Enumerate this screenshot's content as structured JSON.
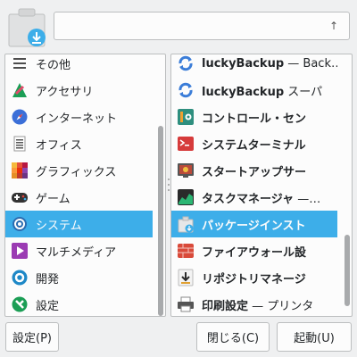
{
  "search": {
    "value": "",
    "placeholder": ""
  },
  "categories": [
    {
      "label": "その他",
      "icon": "list-icon",
      "color": "#4d4d4d"
    },
    {
      "label": "アクセサリ",
      "icon": "accessories-icon",
      "color": "#1b9e55"
    },
    {
      "label": "インターネット",
      "icon": "compass-icon",
      "color": "#3b6fd8"
    },
    {
      "label": "オフィス",
      "icon": "document-icon",
      "color": "#555555"
    },
    {
      "label": "グラフィックス",
      "icon": "graphics-icon",
      "color": "#e8734a"
    },
    {
      "label": "ゲーム",
      "icon": "gamepad-icon",
      "color": "#333333"
    },
    {
      "label": "システム",
      "icon": "gear-icon",
      "color": "#2b6cb0",
      "selected": true
    },
    {
      "label": "マルチメディア",
      "icon": "play-icon",
      "color": "#9b3bb3"
    },
    {
      "label": "開発",
      "icon": "development-icon",
      "color": "#1e88c7"
    },
    {
      "label": "設定",
      "icon": "settings-icon",
      "color": "#1b9e55"
    }
  ],
  "apps": [
    {
      "name": "luckyBackup",
      "desc": " — Back…",
      "icon": "sync-icon"
    },
    {
      "name": "luckyBackup",
      "desc": " スーパ",
      "icon": "sync-icon"
    },
    {
      "name": "コントロール・セン",
      "desc": "",
      "icon": "control-center-icon"
    },
    {
      "name": "システムターミナル",
      "desc": "",
      "icon": "terminal-icon"
    },
    {
      "name": "スタートアップサー",
      "desc": "",
      "icon": "startup-icon"
    },
    {
      "name": "タスクマネージャ",
      "desc": " —…",
      "icon": "task-manager-icon"
    },
    {
      "name": "パッケージインスト",
      "desc": "",
      "icon": "package-installer-icon",
      "selected": true
    },
    {
      "name": "ファイアウォール設",
      "desc": "",
      "icon": "firewall-icon"
    },
    {
      "name": "リポジトリマネージ",
      "desc": "",
      "icon": "repository-icon"
    },
    {
      "name": "印刷設定",
      "desc": " — プリンタ",
      "icon": "printer-icon"
    }
  ],
  "buttons": {
    "settings": "設定(P)",
    "close": "閉じる(C)",
    "launch": "起動(U)"
  },
  "colors": {
    "selection": "#3daee9",
    "accent": "#3daee9"
  }
}
